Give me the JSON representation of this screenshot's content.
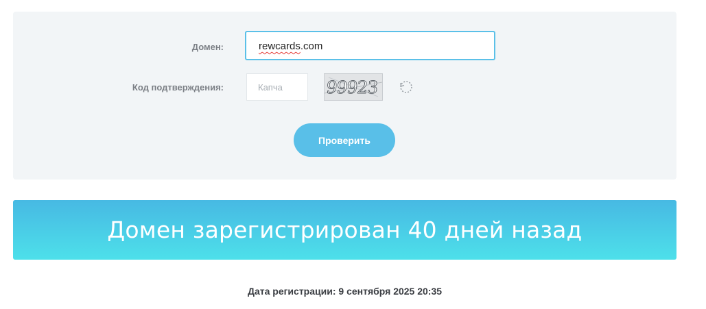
{
  "form": {
    "domain_label": "Домен:",
    "domain_value": "rewcards.com",
    "domain_value_underlined": "rewcards",
    "domain_value_rest": ".com",
    "captcha_label": "Код подтверждения:",
    "captcha_placeholder": "Капча",
    "captcha_image_text": "99923",
    "captcha_refresh_icon": "refresh-icon",
    "submit_label": "Проверить"
  },
  "result": {
    "banner_text": "Домен зарегистрирован 40 дней назад",
    "registration_date": "Дата регистрации: 9 сентября 2025 20:35"
  },
  "colors": {
    "panel_bg": "#f2f5f7",
    "accent": "#59bfe8",
    "banner_gradient_top": "#47b9e3",
    "banner_gradient_bottom": "#4de0ea",
    "label": "#7b7f85",
    "date_text": "#3a3d42"
  }
}
